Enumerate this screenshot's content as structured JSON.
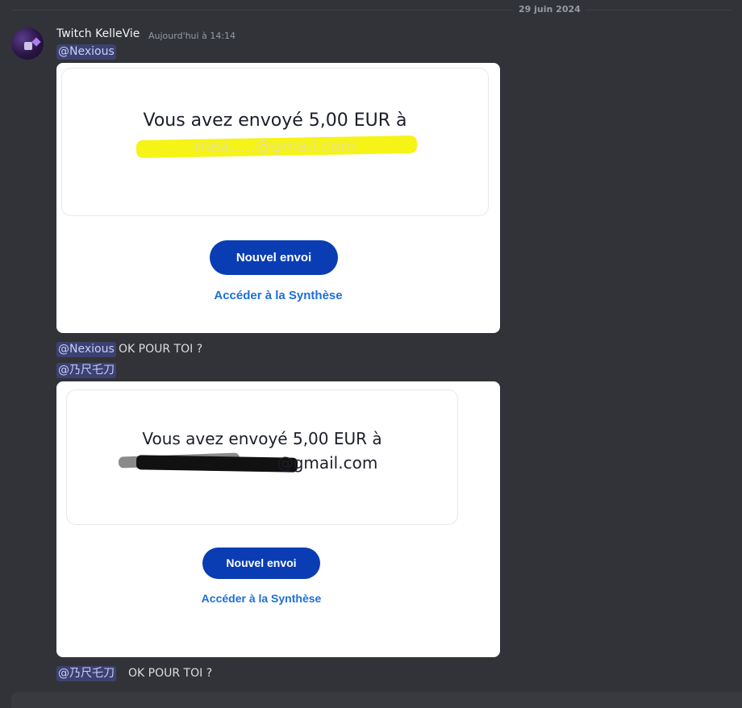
{
  "date_divider": "29 juin 2024",
  "message": {
    "author": "Twitch KelleVie",
    "timestamp": "Aujourd'hui à 14:14",
    "mention_1": "@Nexious",
    "reply_1": {
      "mention": "@Nexious",
      "text": "OK POUR TOI ?"
    },
    "mention_2": "@乃尺乇刀",
    "reply_2": {
      "mention": "@乃尺乇刀",
      "text": "OK POUR TOI ?"
    }
  },
  "attachment_1": {
    "sent_text": "Vous avez envoyé 5,00 EUR à",
    "email_partial": "mea.....@gmail.com",
    "redaction_color": "#f6f20b",
    "button_label": "Nouvel envoi",
    "link_label": "Accéder à la Synthèse"
  },
  "attachment_2": {
    "sent_text": "Vous avez envoyé 5,00 EUR à",
    "email_partial": "@gmail.com",
    "redaction_color": "#111111",
    "button_label": "Nouvel envoi",
    "link_label": "Accéder à la Synthèse"
  },
  "colors": {
    "background": "#313338",
    "mention_bg": "#3c4270",
    "paypal_blue": "#0a3db3",
    "link_blue": "#1d6fd6"
  }
}
